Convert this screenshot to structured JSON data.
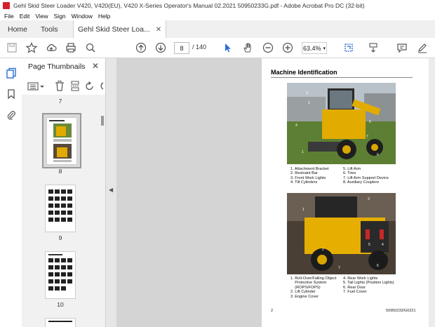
{
  "window": {
    "title": "Gehl Skid Steer Loader V420, V420(EU), V420 X-Series Operator's Manual 02.2021 50950233G.pdf - Adobe Acrobat Pro DC (32-bit)"
  },
  "menu": [
    "File",
    "Edit",
    "View",
    "Sign",
    "Window",
    "Help"
  ],
  "tabs": {
    "home": "Home",
    "tools": "Tools",
    "document": "Gehl Skid Steer Loa..."
  },
  "toolbar": {
    "page_current": "8",
    "page_total": "/ 140",
    "zoom": "63.4%"
  },
  "panel": {
    "title": "Page Thumbnails",
    "labels": [
      "7",
      "8",
      "9",
      "10"
    ]
  },
  "page": {
    "heading": "Machine Identification",
    "legend1_left": "1. Attachment Bracket\n2. Restraint Bar\n3. Front Work Lights\n4. Tilt Cylinders",
    "legend1_right": "5. Lift Arm\n6. Tires\n7. Lift Arm Support Device\n8. Auxiliary Couplers",
    "legend2_left": "1. Roll-Over/Falling Object\n    Protective System\n    (ROPS/FOPS)\n2. Lift Cylinder\n3. Engine Cover",
    "legend2_right": "4. Rear Work Lights\n5. Tail Lights (Position Lights)\n6. Rear Door\n7. Fuel Cover",
    "footer_left": "2",
    "footer_right": "50950233/G0221"
  },
  "colors": {
    "accent": "#2b6fd6",
    "loader": "#e8b000",
    "acrobat": "#d4202b"
  }
}
